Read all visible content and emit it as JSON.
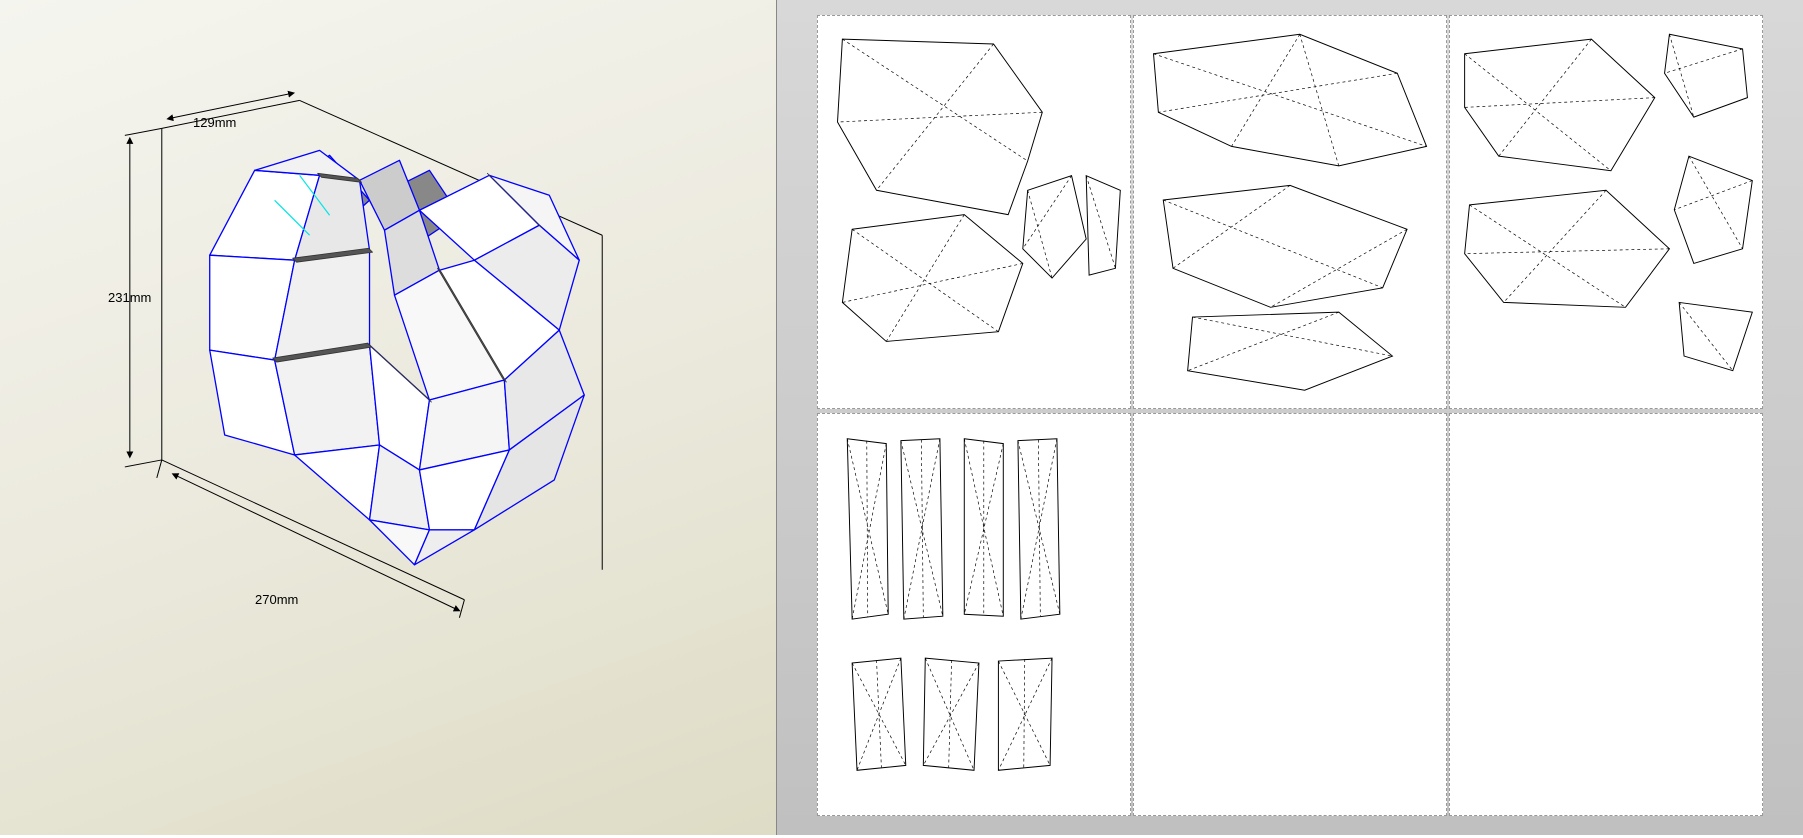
{
  "dimensions": {
    "height_label": "231mm",
    "depth_label": "129mm",
    "width_label": "270mm"
  },
  "colors": {
    "edge_stroke": "#0000ff",
    "inner_edge": "#00ffff",
    "dim_line": "#000000",
    "fold_line": "#000000",
    "cut_line": "#000000",
    "face_light": "#ffffff",
    "face_mid": "#e8e8e8",
    "face_dark": "#bcbcbc",
    "face_shadow": "#888888"
  },
  "model": {
    "type": "low-poly-heart",
    "faces_approx": 60
  },
  "unfold": {
    "page_count": 6,
    "layout": {
      "cols": 3,
      "rows": 2
    }
  }
}
